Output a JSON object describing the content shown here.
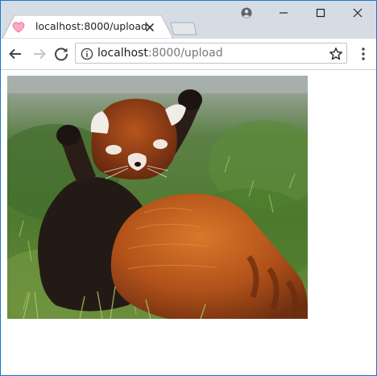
{
  "tab": {
    "title": "localhost:8000/upload",
    "favicon": "heart-icon"
  },
  "window_controls": {
    "profile": "account-circle-icon",
    "minimize": "minimize-icon",
    "maximize": "maximize-icon",
    "close": "close-icon"
  },
  "toolbar": {
    "back": "arrow-left-icon",
    "forward": "arrow-right-icon",
    "reload": "reload-icon",
    "site_info": "info-icon",
    "bookmark": "star-icon",
    "menu": "kebab-menu-icon"
  },
  "address_bar": {
    "host": "localhost",
    "rest": ":8000/upload"
  },
  "page": {
    "image_subject": "red panda"
  },
  "colors": {
    "tabstrip_bg": "#d6dce3",
    "window_border": "#1976c9",
    "favicon_pink": "#f48fb1"
  }
}
